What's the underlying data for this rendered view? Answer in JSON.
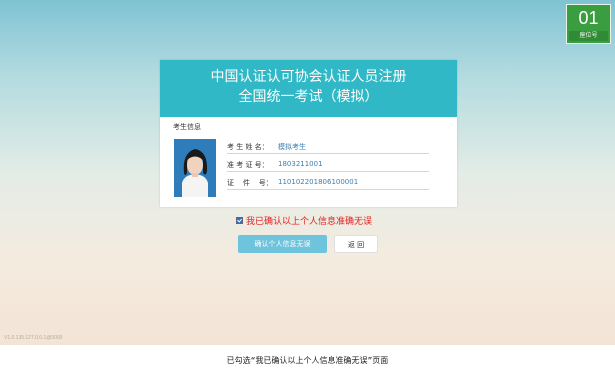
{
  "seat": {
    "number": "01",
    "label": "座位号"
  },
  "header": {
    "title_line1": "中国认证认可协会认证人员注册",
    "title_line2": "全国统一考试（模拟）"
  },
  "candidate": {
    "section_label": "考生信息",
    "fields": [
      {
        "label": "考 生 姓 名：",
        "value": "模拟考生"
      },
      {
        "label": "准 考 证 号：",
        "value": "1803211001"
      },
      {
        "label": "证    件    号：",
        "value": "110102201806100001"
      }
    ]
  },
  "confirm": {
    "checked": true,
    "text": "我已确认以上个人信息准确无误"
  },
  "buttons": {
    "confirm_label": "确认个人信息无误",
    "back_label": "返 回"
  },
  "footer": {
    "version": "V1.0.135.127.0.0.1@0000"
  },
  "caption": "已勾选“我已确认以上个人信息准确无误”页面",
  "colors": {
    "header": "#30b8c6",
    "confirm_button": "#6ec4dc",
    "seat_badge": "#3a9e40",
    "confirm_text": "#e02020"
  }
}
